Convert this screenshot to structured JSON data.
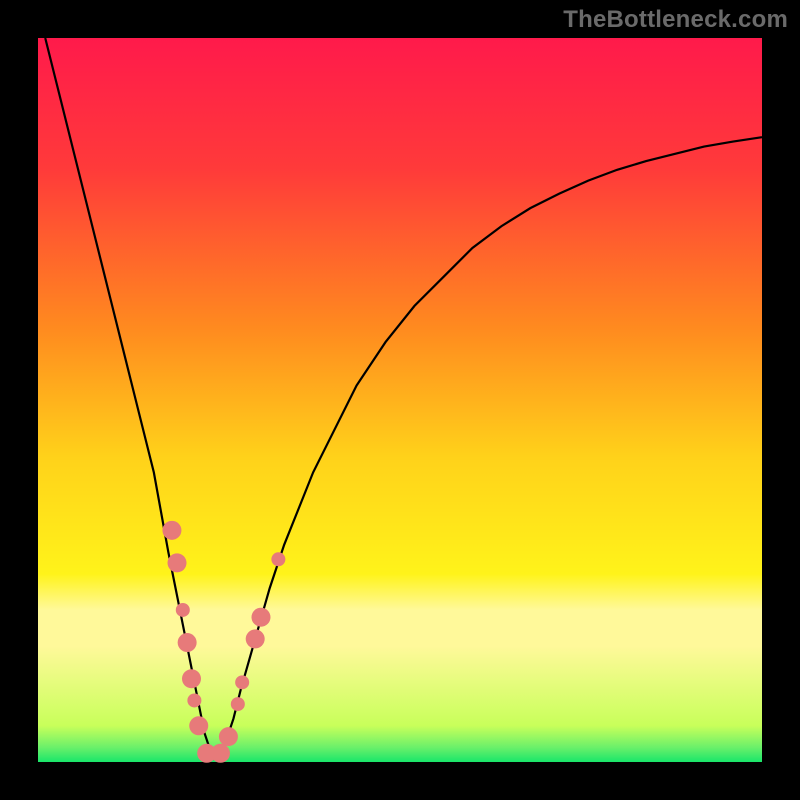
{
  "watermark": "TheBottleneck.com",
  "chart_data": {
    "type": "line",
    "title": "",
    "xlabel": "",
    "ylabel": "",
    "xlim": [
      0,
      100
    ],
    "ylim": [
      0,
      100
    ],
    "grid": false,
    "legend": false,
    "background_gradient_stops": [
      {
        "pct": 0,
        "color": "#ff1a4b"
      },
      {
        "pct": 18,
        "color": "#ff3a3a"
      },
      {
        "pct": 40,
        "color": "#ff8a1f"
      },
      {
        "pct": 58,
        "color": "#ffd21a"
      },
      {
        "pct": 74,
        "color": "#fff31a"
      },
      {
        "pct": 79,
        "color": "#fff99a"
      },
      {
        "pct": 84,
        "color": "#fff99a"
      },
      {
        "pct": 95,
        "color": "#c8ff5a"
      },
      {
        "pct": 98,
        "color": "#6af06a"
      },
      {
        "pct": 100,
        "color": "#19e66a"
      }
    ],
    "series": [
      {
        "name": "bottleneck-curve",
        "color": "#000000",
        "stroke_width": 2.2,
        "x": [
          1,
          3,
          5,
          7,
          9,
          10,
          12,
          14,
          16,
          18,
          19,
          20,
          21,
          22,
          23,
          24,
          25,
          26,
          27,
          28,
          30,
          32,
          34,
          36,
          38,
          40,
          44,
          48,
          52,
          56,
          60,
          64,
          68,
          72,
          76,
          80,
          84,
          88,
          92,
          96,
          100
        ],
        "values": [
          100,
          92,
          84,
          76,
          68,
          64,
          56,
          48,
          40,
          29,
          24,
          19,
          14,
          9,
          4,
          1,
          1,
          3,
          6,
          10,
          17,
          24,
          30,
          35,
          40,
          44,
          52,
          58,
          63,
          67,
          71,
          74,
          76.5,
          78.5,
          80.3,
          81.8,
          83,
          84,
          85,
          85.7,
          86.3
        ]
      }
    ],
    "markers": {
      "name": "benchmark-points",
      "color": "#e77a7a",
      "radius_large": 9.5,
      "radius_small": 7,
      "points": [
        {
          "x": 18.5,
          "y": 32.0,
          "r": "large"
        },
        {
          "x": 19.2,
          "y": 27.5,
          "r": "large"
        },
        {
          "x": 20.0,
          "y": 21.0,
          "r": "small"
        },
        {
          "x": 20.6,
          "y": 16.5,
          "r": "large"
        },
        {
          "x": 21.2,
          "y": 11.5,
          "r": "large"
        },
        {
          "x": 21.6,
          "y": 8.5,
          "r": "small"
        },
        {
          "x": 22.2,
          "y": 5.0,
          "r": "large"
        },
        {
          "x": 23.3,
          "y": 1.2,
          "r": "large"
        },
        {
          "x": 25.2,
          "y": 1.2,
          "r": "large"
        },
        {
          "x": 26.3,
          "y": 3.5,
          "r": "large"
        },
        {
          "x": 27.6,
          "y": 8.0,
          "r": "small"
        },
        {
          "x": 28.2,
          "y": 11.0,
          "r": "small"
        },
        {
          "x": 30.0,
          "y": 17.0,
          "r": "large"
        },
        {
          "x": 30.8,
          "y": 20.0,
          "r": "large"
        },
        {
          "x": 33.2,
          "y": 28.0,
          "r": "small"
        }
      ]
    }
  }
}
